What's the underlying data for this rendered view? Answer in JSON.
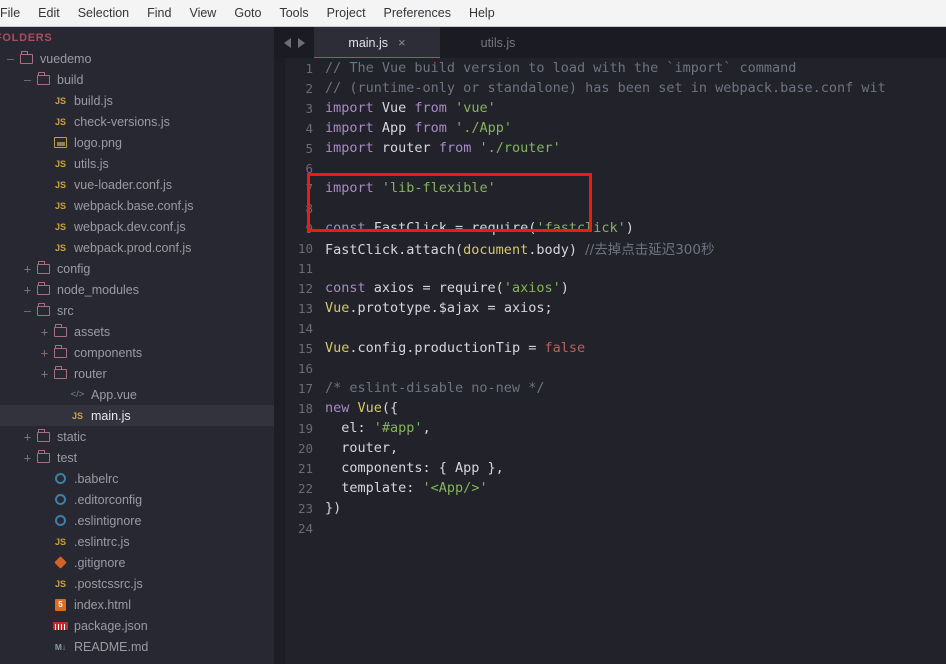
{
  "menubar": {
    "items": [
      {
        "label": "File",
        "clipped": true
      },
      {
        "label": "Edit"
      },
      {
        "label": "Selection"
      },
      {
        "label": "Find"
      },
      {
        "label": "View"
      },
      {
        "label": "Goto"
      },
      {
        "label": "Tools"
      },
      {
        "label": "Project"
      },
      {
        "label": "Preferences"
      },
      {
        "label": "Help"
      }
    ]
  },
  "sidebar": {
    "header": "FOLDERS",
    "tree": [
      {
        "label": "vuedemo",
        "indent": 0,
        "twist": "–",
        "icon": "folder-open-icon",
        "kind": "folder",
        "selected": false
      },
      {
        "label": "build",
        "indent": 1,
        "twist": "–",
        "icon": "folder-open-icon",
        "kind": "folder",
        "selected": false
      },
      {
        "label": "build.js",
        "indent": 2,
        "twist": "",
        "icon": "js-file-icon",
        "kind": "js",
        "selected": false
      },
      {
        "label": "check-versions.js",
        "indent": 2,
        "twist": "",
        "icon": "js-file-icon",
        "kind": "js",
        "selected": false
      },
      {
        "label": "logo.png",
        "indent": 2,
        "twist": "",
        "icon": "image-file-icon",
        "kind": "png",
        "selected": false
      },
      {
        "label": "utils.js",
        "indent": 2,
        "twist": "",
        "icon": "js-file-icon",
        "kind": "js",
        "selected": false
      },
      {
        "label": "vue-loader.conf.js",
        "indent": 2,
        "twist": "",
        "icon": "js-file-icon",
        "kind": "js",
        "selected": false
      },
      {
        "label": "webpack.base.conf.js",
        "indent": 2,
        "twist": "",
        "icon": "js-file-icon",
        "kind": "js",
        "selected": false
      },
      {
        "label": "webpack.dev.conf.js",
        "indent": 2,
        "twist": "",
        "icon": "js-file-icon",
        "kind": "js",
        "selected": false
      },
      {
        "label": "webpack.prod.conf.js",
        "indent": 2,
        "twist": "",
        "icon": "js-file-icon",
        "kind": "js",
        "selected": false
      },
      {
        "label": "config",
        "indent": 1,
        "twist": "+",
        "icon": "folder-icon",
        "kind": "folder",
        "selected": false
      },
      {
        "label": "node_modules",
        "indent": 1,
        "twist": "+",
        "icon": "folder-icon",
        "kind": "folder",
        "selected": false
      },
      {
        "label": "src",
        "indent": 1,
        "twist": "–",
        "icon": "folder-open-icon",
        "kind": "folder",
        "selected": false
      },
      {
        "label": "assets",
        "indent": 2,
        "twist": "+",
        "icon": "folder-icon",
        "kind": "folder",
        "selected": false
      },
      {
        "label": "components",
        "indent": 2,
        "twist": "+",
        "icon": "folder-icon",
        "kind": "folder",
        "selected": false
      },
      {
        "label": "router",
        "indent": 2,
        "twist": "+",
        "icon": "folder-icon",
        "kind": "folder",
        "selected": false
      },
      {
        "label": "App.vue",
        "indent": 3,
        "twist": "",
        "icon": "vue-file-icon",
        "kind": "vue",
        "selected": false
      },
      {
        "label": "main.js",
        "indent": 3,
        "twist": "",
        "icon": "js-file-icon",
        "kind": "js",
        "selected": true
      },
      {
        "label": "static",
        "indent": 1,
        "twist": "+",
        "icon": "folder-icon",
        "kind": "folder",
        "selected": false
      },
      {
        "label": "test",
        "indent": 1,
        "twist": "+",
        "icon": "folder-icon",
        "kind": "folder",
        "selected": false
      },
      {
        "label": ".babelrc",
        "indent": 2,
        "twist": "",
        "icon": "gear-file-icon",
        "kind": "gear",
        "selected": false
      },
      {
        "label": ".editorconfig",
        "indent": 2,
        "twist": "",
        "icon": "gear-file-icon",
        "kind": "gear",
        "selected": false
      },
      {
        "label": ".eslintignore",
        "indent": 2,
        "twist": "",
        "icon": "gear-file-icon",
        "kind": "gear",
        "selected": false
      },
      {
        "label": ".eslintrc.js",
        "indent": 2,
        "twist": "",
        "icon": "js-file-icon",
        "kind": "js",
        "selected": false
      },
      {
        "label": ".gitignore",
        "indent": 2,
        "twist": "",
        "icon": "git-file-icon",
        "kind": "git",
        "selected": false
      },
      {
        "label": ".postcssrc.js",
        "indent": 2,
        "twist": "",
        "icon": "js-file-icon",
        "kind": "js",
        "selected": false
      },
      {
        "label": "index.html",
        "indent": 2,
        "twist": "",
        "icon": "html-file-icon",
        "kind": "html",
        "selected": false
      },
      {
        "label": "package.json",
        "indent": 2,
        "twist": "",
        "icon": "npm-file-icon",
        "kind": "npm",
        "selected": false
      },
      {
        "label": "README.md",
        "indent": 2,
        "twist": "",
        "icon": "markdown-file-icon",
        "kind": "md",
        "selected": false
      }
    ]
  },
  "editor": {
    "tabs": [
      {
        "label": "main.js",
        "active": true,
        "close": "×"
      },
      {
        "label": "utils.js",
        "active": false,
        "close": ""
      }
    ],
    "nav": {
      "prev": "◀",
      "next": "▶"
    },
    "lines": [
      {
        "n": "1",
        "tokens": [
          {
            "t": "// The Vue build version to load with the `import` command",
            "c": "t-com"
          }
        ]
      },
      {
        "n": "2",
        "tokens": [
          {
            "t": "// (runtime-only or standalone) has been set in webpack.base.conf wit",
            "c": "t-com"
          }
        ]
      },
      {
        "n": "3",
        "tokens": [
          {
            "t": "import",
            "c": "t-kw"
          },
          {
            "t": " Vue ",
            "c": "t-pl"
          },
          {
            "t": "from",
            "c": "t-kw"
          },
          {
            "t": " ",
            "c": "t-pl"
          },
          {
            "t": "'vue'",
            "c": "t-str"
          }
        ]
      },
      {
        "n": "4",
        "tokens": [
          {
            "t": "import",
            "c": "t-kw"
          },
          {
            "t": " App ",
            "c": "t-pl"
          },
          {
            "t": "from",
            "c": "t-kw"
          },
          {
            "t": " ",
            "c": "t-pl"
          },
          {
            "t": "'./App'",
            "c": "t-str"
          }
        ]
      },
      {
        "n": "5",
        "tokens": [
          {
            "t": "import",
            "c": "t-kw"
          },
          {
            "t": " router ",
            "c": "t-pl"
          },
          {
            "t": "from",
            "c": "t-kw"
          },
          {
            "t": " ",
            "c": "t-pl"
          },
          {
            "t": "'./router'",
            "c": "t-str"
          }
        ]
      },
      {
        "n": "6",
        "tokens": []
      },
      {
        "n": "7",
        "tokens": [
          {
            "t": "import",
            "c": "t-kw"
          },
          {
            "t": " ",
            "c": "t-pl"
          },
          {
            "t": "'lib-flexible'",
            "c": "t-str"
          }
        ]
      },
      {
        "n": "8",
        "tokens": []
      },
      {
        "n": "9",
        "tokens": [
          {
            "t": "const",
            "c": "t-kw"
          },
          {
            "t": " FastClick = require(",
            "c": "t-pl"
          },
          {
            "t": "'fastclick'",
            "c": "t-str"
          },
          {
            "t": ")",
            "c": "t-pl"
          }
        ]
      },
      {
        "n": "10",
        "tokens": [
          {
            "t": "FastClick.attach(",
            "c": "t-pl"
          },
          {
            "t": "document",
            "c": "t-cls"
          },
          {
            "t": ".body) ",
            "c": "t-pl"
          },
          {
            "t": "//去掉点击延迟300秒",
            "c": "t-cjk"
          }
        ]
      },
      {
        "n": "11",
        "tokens": []
      },
      {
        "n": "12",
        "tokens": [
          {
            "t": "const",
            "c": "t-kw"
          },
          {
            "t": " axios = require(",
            "c": "t-pl"
          },
          {
            "t": "'axios'",
            "c": "t-str"
          },
          {
            "t": ")",
            "c": "t-pl"
          }
        ]
      },
      {
        "n": "13",
        "tokens": [
          {
            "t": "Vue",
            "c": "t-cls"
          },
          {
            "t": ".prototype.$ajax = axios;",
            "c": "t-pl"
          }
        ]
      },
      {
        "n": "14",
        "tokens": []
      },
      {
        "n": "15",
        "tokens": [
          {
            "t": "Vue",
            "c": "t-cls"
          },
          {
            "t": ".config.productionTip = ",
            "c": "t-pl"
          },
          {
            "t": "false",
            "c": "t-lit"
          }
        ]
      },
      {
        "n": "16",
        "tokens": []
      },
      {
        "n": "17",
        "tokens": [
          {
            "t": "/* eslint-disable no-new */",
            "c": "t-com"
          }
        ]
      },
      {
        "n": "18",
        "tokens": [
          {
            "t": "new",
            "c": "t-kw"
          },
          {
            "t": " ",
            "c": "t-pl"
          },
          {
            "t": "Vue",
            "c": "t-cls"
          },
          {
            "t": "({",
            "c": "t-pl"
          }
        ]
      },
      {
        "n": "19",
        "tokens": [
          {
            "t": "  el: ",
            "c": "t-pl"
          },
          {
            "t": "'#app'",
            "c": "t-str"
          },
          {
            "t": ",",
            "c": "t-pl"
          }
        ]
      },
      {
        "n": "20",
        "tokens": [
          {
            "t": "  router,",
            "c": "t-pl"
          }
        ]
      },
      {
        "n": "21",
        "tokens": [
          {
            "t": "  components: { App },",
            "c": "t-pl"
          }
        ]
      },
      {
        "n": "22",
        "tokens": [
          {
            "t": "  template: ",
            "c": "t-pl"
          },
          {
            "t": "'<App/>'",
            "c": "t-str"
          }
        ]
      },
      {
        "n": "23",
        "tokens": [
          {
            "t": "})",
            "c": "t-pl"
          }
        ]
      },
      {
        "n": "24",
        "tokens": []
      }
    ],
    "annotation": {
      "shape": "rectangle",
      "color": "#f01b0d",
      "covers_lines": "6-8"
    }
  }
}
